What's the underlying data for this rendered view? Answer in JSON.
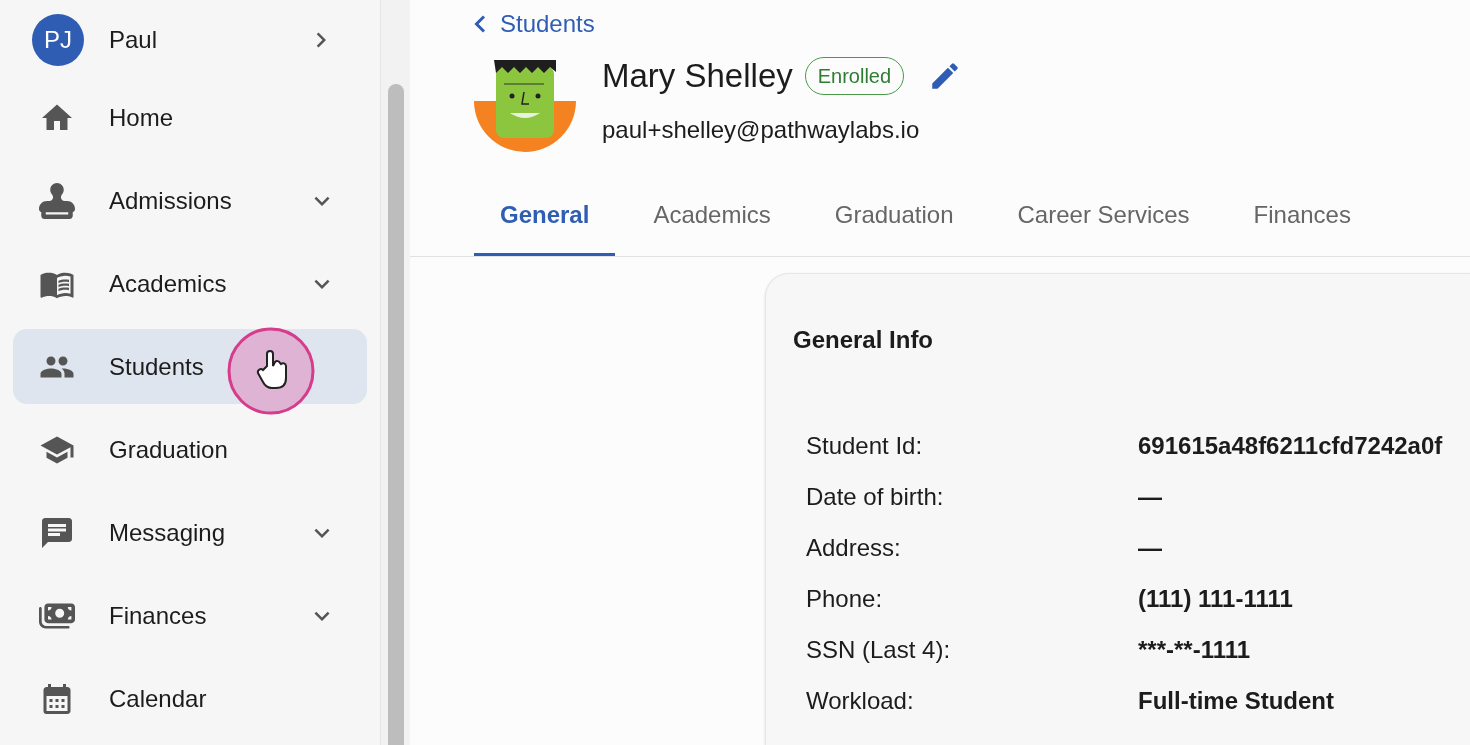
{
  "user": {
    "initials": "PJ",
    "name": "Paul"
  },
  "nav": [
    {
      "label": "Home",
      "expandable": false,
      "selected": false
    },
    {
      "label": "Admissions",
      "expandable": true,
      "selected": false
    },
    {
      "label": "Academics",
      "expandable": true,
      "selected": false
    },
    {
      "label": "Students",
      "expandable": false,
      "selected": true
    },
    {
      "label": "Graduation",
      "expandable": false,
      "selected": false
    },
    {
      "label": "Messaging",
      "expandable": true,
      "selected": false
    },
    {
      "label": "Finances",
      "expandable": true,
      "selected": false
    },
    {
      "label": "Calendar",
      "expandable": false,
      "selected": false
    }
  ],
  "breadcrumb": "Students",
  "student": {
    "name": "Mary Shelley",
    "status": "Enrolled",
    "email": "paul+shelley@pathwaylabs.io"
  },
  "tabs": [
    {
      "label": "General",
      "selected": true
    },
    {
      "label": "Academics",
      "selected": false
    },
    {
      "label": "Graduation",
      "selected": false
    },
    {
      "label": "Career Services",
      "selected": false
    },
    {
      "label": "Finances",
      "selected": false
    }
  ],
  "card": {
    "title": "General Info",
    "rows": [
      {
        "label": "Student Id:",
        "value": "691615a48f6211cfd7242a0f"
      },
      {
        "label": "Date of birth:",
        "value": "—"
      },
      {
        "label": "Address:",
        "value": "—"
      },
      {
        "label": "Phone:",
        "value": "(111) 111-1111"
      },
      {
        "label": "SSN (Last 4):",
        "value": "***-**-1111"
      },
      {
        "label": "Workload:",
        "value": "Full-time Student"
      }
    ]
  }
}
